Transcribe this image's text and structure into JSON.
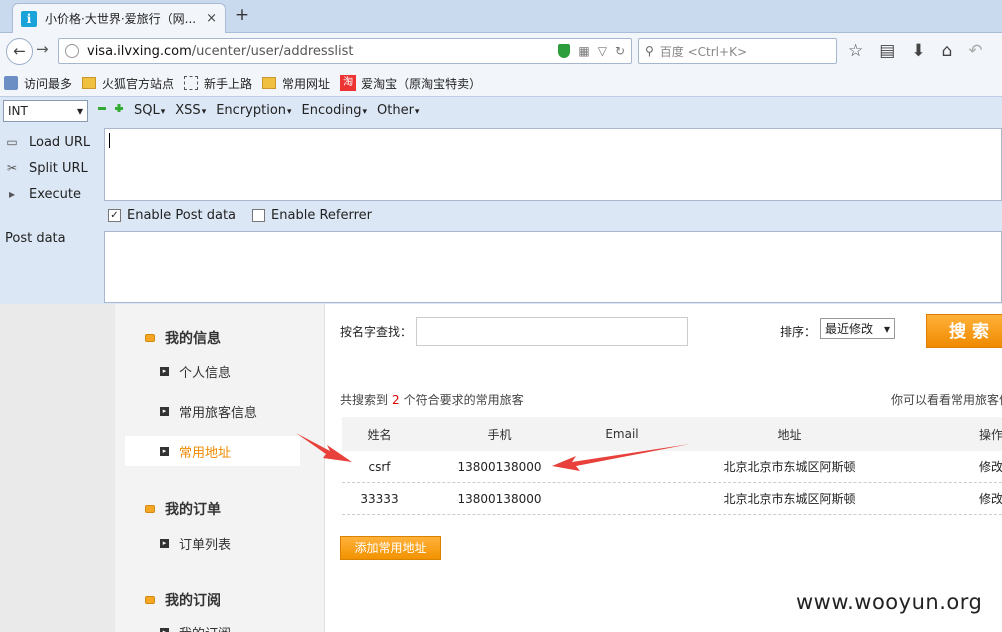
{
  "browser": {
    "tab_title": "小价格·大世界·爱旅行（网...",
    "tab_close": "×",
    "new_tab": "+",
    "url_host": "visa.ilvxing.com",
    "url_path": "/ucenter/user/addresslist",
    "search_placeholder": "百度 <Ctrl+K>",
    "bookmarks": [
      "访问最多",
      "火狐官方站点",
      "新手上路",
      "常用网址",
      "爱淘宝（原淘宝特卖）"
    ],
    "tao_glyph": "淘"
  },
  "hackbar": {
    "select_value": "INT",
    "menus": [
      "SQL",
      "XSS",
      "Encryption",
      "Encoding",
      "Other"
    ],
    "load_url": "Load URL",
    "split_url": "Split URL",
    "execute": "Execute",
    "enable_post": "Enable Post data",
    "enable_referrer": "Enable Referrer",
    "post_label": "Post data",
    "url_value": ""
  },
  "sidebar": {
    "group1": "我的信息",
    "item1": "个人信息",
    "item2": "常用旅客信息",
    "item3": "常用地址",
    "group2": "我的订单",
    "item4": "订单列表",
    "group3": "我的订阅",
    "item5": "我的订阅"
  },
  "main": {
    "search_label": "按名字查找：",
    "sort_label": "排序：",
    "sort_value": "最近修改",
    "search_button": "搜索",
    "result_prefix": "共搜索到",
    "result_count": "2",
    "result_suffix": "个符合要求的常用旅客",
    "result_hint": "你可以看看常用旅客信",
    "columns": [
      "姓名",
      "手机",
      "Email",
      "地址",
      "操作"
    ],
    "rows": [
      {
        "name": "csrf",
        "phone": "13800138000",
        "email": "",
        "address": "北京北京市东城区阿斯顿",
        "op": "修改 | 删"
      },
      {
        "name": "33333",
        "phone": "13800138000",
        "email": "",
        "address": "北京北京市东城区阿斯顿",
        "op": "修改 | 删"
      }
    ],
    "add_button": "添加常用地址"
  },
  "watermark": "www.wooyun.org",
  "colors": {
    "accent": "#f08a00",
    "arrow": "#e8403a",
    "count": "#dd0000"
  }
}
